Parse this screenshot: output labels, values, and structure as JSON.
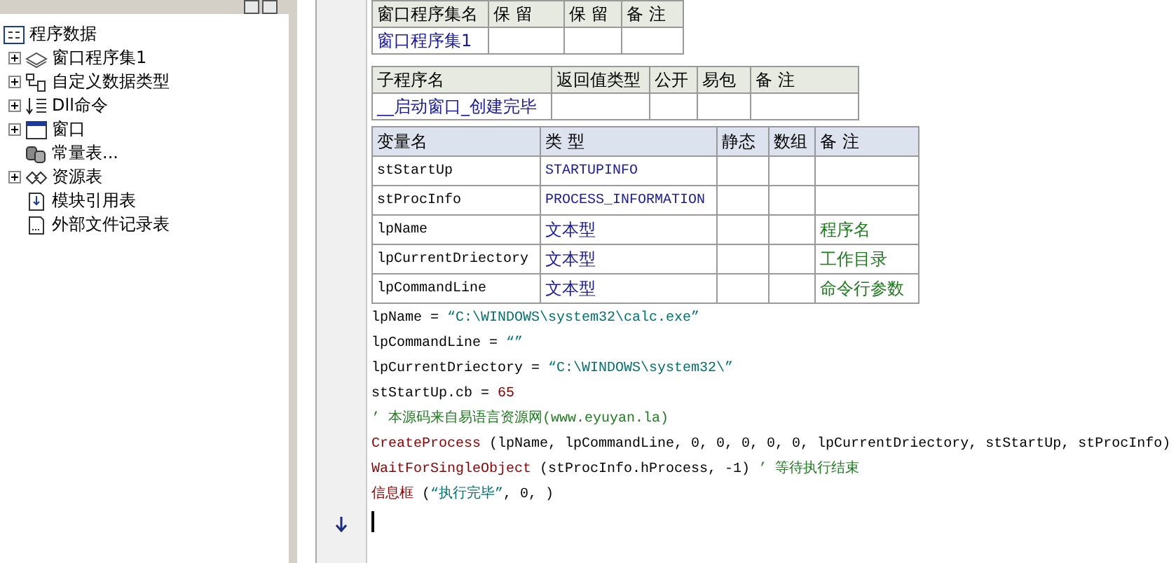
{
  "tree": {
    "label": "程序数据",
    "children": [
      {
        "label": "窗口程序集1",
        "kind": "group",
        "expanded": false
      },
      {
        "label": "自定义数据类型",
        "kind": "group",
        "expanded": false
      },
      {
        "label": "Dll命令",
        "kind": "group",
        "expanded": false
      },
      {
        "label": "窗口",
        "kind": "group",
        "expanded": false
      },
      {
        "label": "常量表...",
        "kind": "leaf"
      },
      {
        "label": "资源表",
        "kind": "group",
        "expanded": false
      },
      {
        "label": "模块引用表",
        "kind": "leaf"
      },
      {
        "label": "外部文件记录表",
        "kind": "leaf"
      }
    ]
  },
  "tables": [
    {
      "columns": [
        "窗口程序集名",
        "保 留",
        "保 留",
        "备 注"
      ],
      "rows": [
        [
          "窗口程序集1",
          "",
          "",
          ""
        ]
      ]
    },
    {
      "columns": [
        "子程序名",
        "返回值类型",
        "公开",
        "易包",
        "备 注"
      ],
      "rows": [
        [
          "__启动窗口_创建完毕",
          "",
          "",
          "",
          ""
        ]
      ]
    },
    {
      "columns": [
        "变量名",
        "类 型",
        "静态",
        "数组",
        "备 注"
      ],
      "rows": [
        [
          "stStartUp",
          "STARTUPINFO",
          "",
          "",
          ""
        ],
        [
          "stProcInfo",
          "PROCESS_INFORMATION",
          "",
          "",
          ""
        ],
        [
          "lpName",
          "文本型",
          "",
          "",
          "程序名"
        ],
        [
          "lpCurrentDriectory",
          "文本型",
          "",
          "",
          "工作目录"
        ],
        [
          "lpCommandLine",
          "文本型",
          "",
          "",
          "命令行参数"
        ]
      ]
    }
  ],
  "code_lines": [
    [
      {
        "kind": "plain",
        "text": "lpName = "
      },
      {
        "kind": "string",
        "text": "“C:\\WINDOWS\\system32\\calc.exe”"
      }
    ],
    [
      {
        "kind": "plain",
        "text": "lpCommandLine = "
      },
      {
        "kind": "string",
        "text": "“”"
      }
    ],
    [
      {
        "kind": "plain",
        "text": "lpCurrentDriectory = "
      },
      {
        "kind": "string",
        "text": "“C:\\WINDOWS\\system32\\”"
      }
    ],
    [
      {
        "kind": "plain",
        "text": "stStartUp.cb = "
      },
      {
        "kind": "number",
        "text": "65"
      }
    ],
    [
      {
        "kind": "comment",
        "text": "’ 本源码来自易语言资源网(www.eyuyan.la)"
      }
    ],
    [
      {
        "kind": "command",
        "text": "CreateProcess"
      },
      {
        "kind": "plain",
        "text": " (lpName, lpCommandLine, 0, 0, 0, 0, 0, lpCurrentDriectory, stStartUp, stProcInfo)"
      }
    ],
    [
      {
        "kind": "command",
        "text": "WaitForSingleObject"
      },
      {
        "kind": "plain",
        "text": " (stProcInfo.hProcess, -1) "
      },
      {
        "kind": "comment",
        "text": "’ 等待执行结束"
      }
    ],
    [
      {
        "kind": "command",
        "text": "信息框"
      },
      {
        "kind": "plain",
        "text": " ("
      },
      {
        "kind": "string",
        "text": "“执行完毕”"
      },
      {
        "kind": "plain",
        "text": ", 0, )"
      }
    ]
  ]
}
